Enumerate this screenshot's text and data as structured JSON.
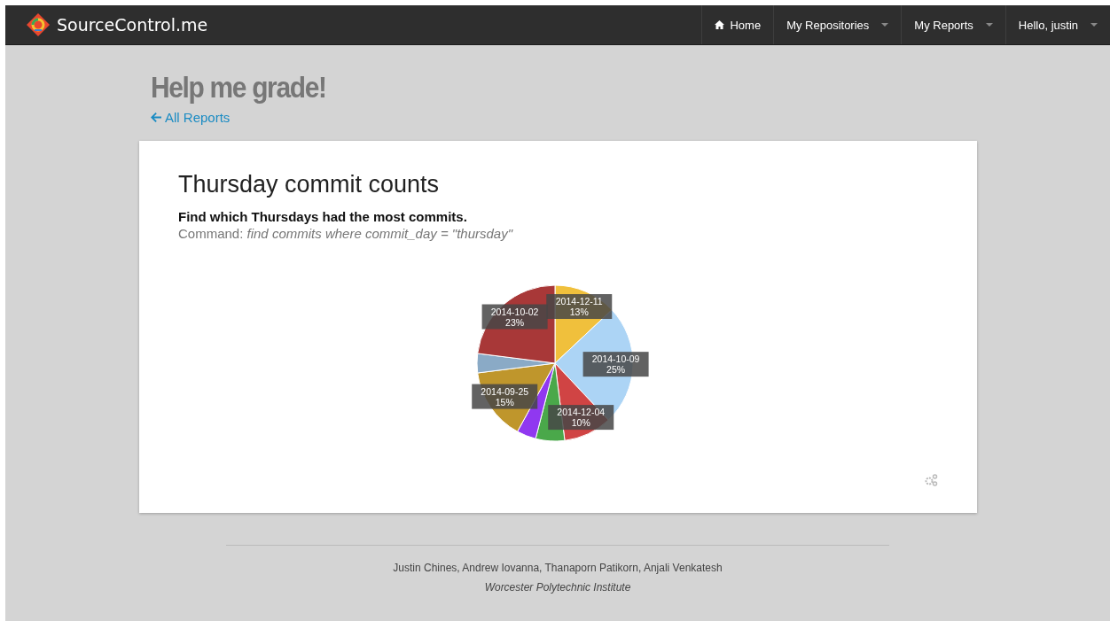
{
  "navbar": {
    "brand": "SourceControl.me",
    "items": [
      {
        "label": "Home",
        "kind": "home"
      },
      {
        "label": "My Repositories",
        "kind": "dropdown"
      },
      {
        "label": "My Reports",
        "kind": "dropdown"
      },
      {
        "label": "Hello, justin",
        "kind": "dropdown"
      }
    ]
  },
  "page": {
    "title": "Help me grade!",
    "back_link": "All Reports"
  },
  "report": {
    "title": "Thursday commit counts",
    "description": "Find which Thursdays had the most commits.",
    "command_label": "Command:",
    "command": "find commits where commit_day = \"thursday\"",
    "chart_data": {
      "type": "pie",
      "value_labels": [
        "13%",
        "25%",
        "10%",
        null,
        null,
        "15%",
        null,
        "23%"
      ],
      "categories": [
        "2014-12-11",
        "2014-10-09",
        "2014-12-04",
        null,
        null,
        "2014-09-25",
        null,
        "2014-10-02"
      ],
      "colors": [
        "#f0c03c",
        "#acd4f5",
        "#d04444",
        "#4aa84a",
        "#9038f0",
        "#bf962c",
        "#8aaac6",
        "#a83838"
      ],
      "values": [
        13,
        25,
        10,
        6,
        4,
        15,
        4,
        23
      ]
    }
  },
  "footer": {
    "authors": "Justin Chines, Andrew Iovanna, Thanaporn Patikorn, Anjali Venkatesh",
    "institution": "Worcester Polytechnic Institute"
  }
}
